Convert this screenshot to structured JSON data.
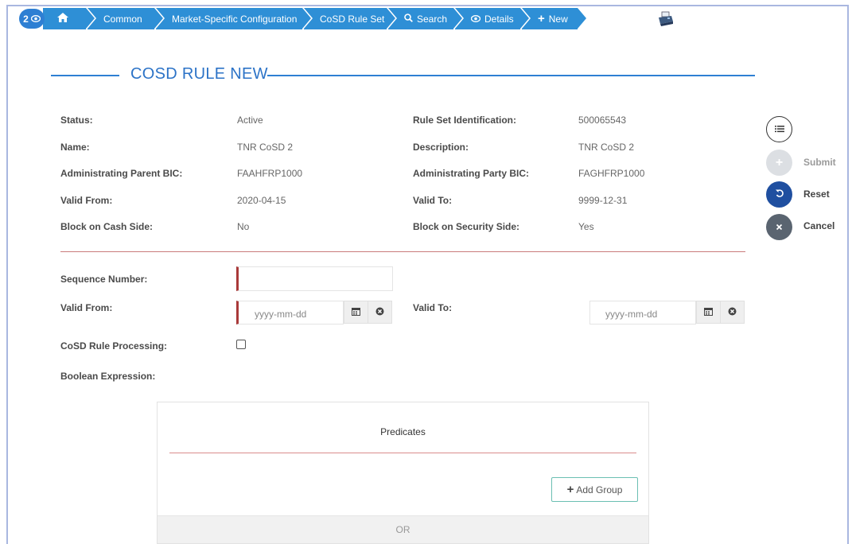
{
  "breadcrumb": {
    "badge_count": "2",
    "items": [
      {
        "label": ""
      },
      {
        "label": "Common"
      },
      {
        "label": "Market-Specific Configuration"
      },
      {
        "label": "CoSD Rule Set"
      },
      {
        "label": "Search"
      },
      {
        "label": "Details"
      },
      {
        "label": "New"
      }
    ]
  },
  "title": "COSD RULE NEW",
  "details": {
    "status_label": "Status:",
    "status_value": "Active",
    "rule_set_id_label": "Rule Set Identification:",
    "rule_set_id_value": "500065543",
    "name_label": "Name:",
    "name_value": "TNR CoSD 2",
    "description_label": "Description:",
    "description_value": "TNR CoSD 2",
    "admin_parent_bic_label": "Administrating Parent BIC:",
    "admin_parent_bic_value": "FAAHFRP1000",
    "admin_party_bic_label": "Administrating Party BIC:",
    "admin_party_bic_value": "FAGHFRP1000",
    "valid_from_label": "Valid From:",
    "valid_from_value": "2020-04-15",
    "valid_to_label": "Valid To:",
    "valid_to_value": "9999-12-31",
    "block_cash_label": "Block on Cash Side:",
    "block_cash_value": "No",
    "block_security_label": "Block on Security Side:",
    "block_security_value": "Yes"
  },
  "form": {
    "sequence_number_label": "Sequence Number:",
    "sequence_number_value": "",
    "valid_from_label": "Valid From:",
    "valid_from_placeholder": "yyyy-mm-dd",
    "valid_to_label": "Valid To:",
    "valid_to_placeholder": "yyyy-mm-dd",
    "cosd_processing_label": "CoSD Rule Processing:",
    "boolean_expression_label": "Boolean Expression:"
  },
  "actions": {
    "submit": "Submit",
    "reset": "Reset",
    "cancel": "Cancel"
  },
  "predicates": {
    "title": "Predicates",
    "add_group": "Add Group",
    "or_label": "OR"
  },
  "colors": {
    "accent": "#2e7fd3",
    "required_bar": "#a93a3a",
    "reset_button": "#1f4fa0",
    "cancel_button": "#5a6470"
  }
}
